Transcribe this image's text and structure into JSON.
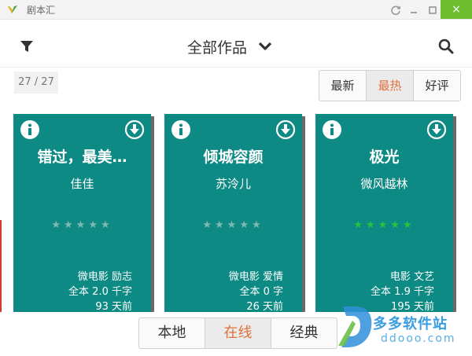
{
  "window": {
    "title": "剧本汇",
    "close_glyph": "×",
    "accent": "#6dbe2e"
  },
  "header": {
    "title": "全部作品"
  },
  "count": "27 / 27",
  "sort_tabs": [
    {
      "label": "最新",
      "active": false
    },
    {
      "label": "最热",
      "active": true
    },
    {
      "label": "好评",
      "active": false
    }
  ],
  "cards": [
    {
      "title": "错过，最美…",
      "author": "佳佳",
      "rating": 0,
      "genre": "微电影 励志",
      "words": "全本 2.0 千字",
      "time": "93 天前"
    },
    {
      "title": "倾城容颜",
      "author": "苏泠儿",
      "rating": 0,
      "genre": "微电影 爱情",
      "words": "全本 0 字",
      "time": "26 天前"
    },
    {
      "title": "极光",
      "author": "微风越林",
      "rating": 5,
      "genre": "电影 文艺",
      "words": "全本 1.9 千字",
      "time": "195 天前"
    }
  ],
  "bottom_tabs": [
    {
      "label": "本地",
      "active": false
    },
    {
      "label": "在线",
      "active": true
    },
    {
      "label": "经典",
      "active": false
    }
  ],
  "watermark": {
    "name": "多多软件站",
    "url": "ddooo.com"
  },
  "colors": {
    "card": "#0e8a84",
    "active_tab_text": "#e2703a",
    "star_on": "#25c43f",
    "star_off": "#7fb8b4"
  },
  "icons": [
    "app-logo-icon",
    "refresh-icon",
    "minimize-icon",
    "maximize-icon",
    "close-icon",
    "filter-icon",
    "chevron-down-icon",
    "search-icon",
    "info-icon",
    "download-icon",
    "star-icon"
  ]
}
